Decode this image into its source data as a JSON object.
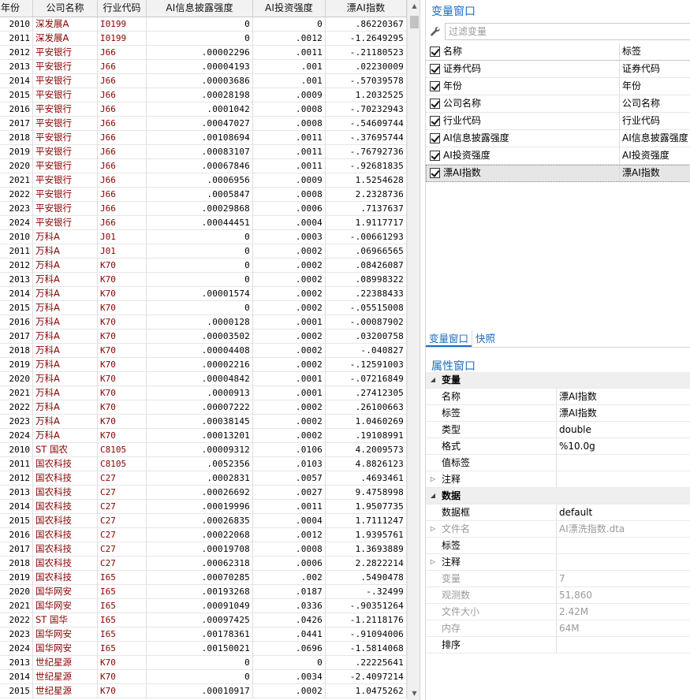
{
  "grid": {
    "columns": {
      "year": "年份",
      "company": "公司名称",
      "industry": "行业代码",
      "ai_disclosure": "AI信息披露强度",
      "ai_invest": "AI投资强度",
      "drift_ai": "漂AI指数"
    },
    "rows": [
      [
        "2010",
        "深发展A",
        "I0199",
        "0",
        "0",
        ".86220367"
      ],
      [
        "2011",
        "深发展A",
        "I0199",
        "0",
        ".0012",
        "-1.2649295"
      ],
      [
        "2012",
        "平安银行",
        "J66",
        ".00002296",
        ".0011",
        "-.21180523"
      ],
      [
        "2013",
        "平安银行",
        "J66",
        ".00004193",
        ".001",
        ".02230009"
      ],
      [
        "2014",
        "平安银行",
        "J66",
        ".00003686",
        ".001",
        "-.57039578"
      ],
      [
        "2015",
        "平安银行",
        "J66",
        ".00028198",
        ".0009",
        "1.2032525"
      ],
      [
        "2016",
        "平安银行",
        "J66",
        ".0001042",
        ".0008",
        "-.70232943"
      ],
      [
        "2017",
        "平安银行",
        "J66",
        ".00047027",
        ".0008",
        "-.54609744"
      ],
      [
        "2018",
        "平安银行",
        "J66",
        ".00108694",
        ".0011",
        "-.37695744"
      ],
      [
        "2019",
        "平安银行",
        "J66",
        ".00083107",
        ".0011",
        "-.76792736"
      ],
      [
        "2020",
        "平安银行",
        "J66",
        ".00067846",
        ".0011",
        "-.92681835"
      ],
      [
        "2021",
        "平安银行",
        "J66",
        ".0006956",
        ".0009",
        "1.5254628"
      ],
      [
        "2022",
        "平安银行",
        "J66",
        ".0005847",
        ".0008",
        "2.2328736"
      ],
      [
        "2023",
        "平安银行",
        "J66",
        ".00029868",
        ".0006",
        ".7137637"
      ],
      [
        "2024",
        "平安银行",
        "J66",
        ".00044451",
        ".0004",
        "1.9117717"
      ],
      [
        "2010",
        "万科A",
        "J01",
        "0",
        ".0003",
        "-.00661293"
      ],
      [
        "2011",
        "万科A",
        "J01",
        "0",
        ".0002",
        ".06966565"
      ],
      [
        "2012",
        "万科A",
        "K70",
        "0",
        ".0002",
        ".08426087"
      ],
      [
        "2013",
        "万科A",
        "K70",
        "0",
        ".0002",
        ".08998322"
      ],
      [
        "2014",
        "万科A",
        "K70",
        ".00001574",
        ".0002",
        ".22388433"
      ],
      [
        "2015",
        "万科A",
        "K70",
        "0",
        ".0002",
        "-.05515008"
      ],
      [
        "2016",
        "万科A",
        "K70",
        ".0000128",
        ".0001",
        "-.00087902"
      ],
      [
        "2017",
        "万科A",
        "K70",
        ".00003502",
        ".0002",
        ".03200758"
      ],
      [
        "2018",
        "万科A",
        "K70",
        ".00004408",
        ".0002",
        "-.040827"
      ],
      [
        "2019",
        "万科A",
        "K70",
        ".00002216",
        ".0002",
        "-.12591003"
      ],
      [
        "2020",
        "万科A",
        "K70",
        ".00004842",
        ".0001",
        "-.07216849"
      ],
      [
        "2021",
        "万科A",
        "K70",
        ".0000913",
        ".0001",
        ".27412305"
      ],
      [
        "2022",
        "万科A",
        "K70",
        ".00007222",
        ".0002",
        ".26100663"
      ],
      [
        "2023",
        "万科A",
        "K70",
        ".00038145",
        ".0002",
        "1.0460269"
      ],
      [
        "2024",
        "万科A",
        "K70",
        ".00013201",
        ".0002",
        ".19108991"
      ],
      [
        "2010",
        "ST 国农",
        "C8105",
        ".00009312",
        ".0106",
        "4.2009573"
      ],
      [
        "2011",
        "国农科技",
        "C8105",
        ".0052356",
        ".0103",
        "4.8826123"
      ],
      [
        "2012",
        "国农科技",
        "C27",
        ".0002831",
        ".0057",
        ".4693461"
      ],
      [
        "2013",
        "国农科技",
        "C27",
        ".00026692",
        ".0027",
        "9.4758998"
      ],
      [
        "2014",
        "国农科技",
        "C27",
        ".00019996",
        ".0011",
        "1.9507735"
      ],
      [
        "2015",
        "国农科技",
        "C27",
        ".00026835",
        ".0004",
        "1.7111247"
      ],
      [
        "2016",
        "国农科技",
        "C27",
        ".00022068",
        ".0012",
        "1.9395761"
      ],
      [
        "2017",
        "国农科技",
        "C27",
        ".00019708",
        ".0008",
        "1.3693889"
      ],
      [
        "2018",
        "国农科技",
        "C27",
        ".00062318",
        ".0006",
        "2.2822214"
      ],
      [
        "2019",
        "国农科技",
        "I65",
        ".00070285",
        ".002",
        ".5490478"
      ],
      [
        "2020",
        "国华网安",
        "I65",
        ".00193268",
        ".0187",
        "-.32499"
      ],
      [
        "2021",
        "国华网安",
        "I65",
        ".00091049",
        ".0336",
        "-.90351264"
      ],
      [
        "2022",
        "ST 国华",
        "I65",
        ".00097425",
        ".0426",
        "-1.2118176"
      ],
      [
        "2023",
        "国华网安",
        "I65",
        ".00178361",
        ".0441",
        "-.91094006"
      ],
      [
        "2024",
        "国华网安",
        "I65",
        ".00150021",
        ".0696",
        "-1.5814068"
      ],
      [
        "2013",
        "世纪星源",
        "K70",
        "0",
        "0",
        ".22225641"
      ],
      [
        "2014",
        "世纪星源",
        "K70",
        "0",
        ".0034",
        "-2.4097214"
      ],
      [
        "2015",
        "世纪星源",
        "K70",
        ".00010917",
        ".0002",
        "1.0475262"
      ]
    ]
  },
  "var_window": {
    "title": "变量窗口",
    "filter_placeholder": "过滤变量",
    "col_name": "名称",
    "col_label": "标签",
    "vars": [
      {
        "name": "证券代码",
        "label": "证券代码"
      },
      {
        "name": "年份",
        "label": "年份"
      },
      {
        "name": "公司名称",
        "label": "公司名称"
      },
      {
        "name": "行业代码",
        "label": "行业代码"
      },
      {
        "name": "AI信息披露强度",
        "label": "AI信息披露强度"
      },
      {
        "name": "AI投资强度",
        "label": "AI投资强度"
      },
      {
        "name": "漂AI指数",
        "label": "漂AI指数"
      }
    ],
    "tabs": [
      "变量窗口",
      "快照"
    ]
  },
  "prop_window": {
    "title": "属性窗口",
    "group_var": "变量",
    "group_data": "数据",
    "var_props": [
      {
        "key": "名称",
        "value": "漂AI指数"
      },
      {
        "key": "标签",
        "value": "漂AI指数"
      },
      {
        "key": "类型",
        "value": "double"
      },
      {
        "key": "格式",
        "value": "%10.0g"
      },
      {
        "key": "值标签",
        "value": ""
      },
      {
        "key": "注释",
        "value": ""
      }
    ],
    "data_props": [
      {
        "key": "数据框",
        "value": "default"
      },
      {
        "key": "文件名",
        "value": "AI漂洗指数.dta"
      },
      {
        "key": "标签",
        "value": ""
      },
      {
        "key": "注释",
        "value": ""
      },
      {
        "key": "变量",
        "value": "7"
      },
      {
        "key": "观测数",
        "value": "51,860"
      },
      {
        "key": "文件大小",
        "value": "2.42M"
      },
      {
        "key": "内存",
        "value": "64M"
      },
      {
        "key": "排序",
        "value": ""
      }
    ]
  }
}
